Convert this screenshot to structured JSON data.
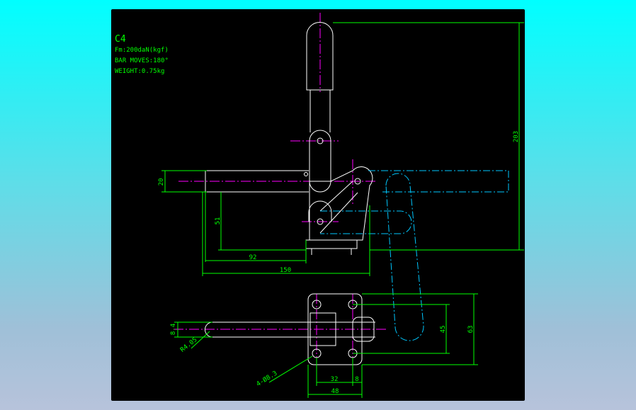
{
  "notes": {
    "title": "C4",
    "force": "Fm:200daN(kgf)",
    "bar_moves": "BAR MOVES:180°",
    "weight": "WEIGHT:0.75kg"
  },
  "dimensions": {
    "height_overall": "203",
    "bar_height": "20",
    "pivot_height": "51",
    "length_to_pivot": "92",
    "length_overall": "150",
    "slot_width": "8.4",
    "slot_radius": "R4.05",
    "hole_diameter": "4-Ø8.3",
    "base_hole_spacing": "32",
    "base_edge": "8",
    "base_width": "48",
    "base_hole_spacing_v": "45",
    "base_depth": "63"
  },
  "colors": {
    "background_top": "#00ffff",
    "canvas": "#000000",
    "outline": "#ffffff",
    "dimension": "#00ff00",
    "centerline": "#ff00ff",
    "phantom": "#00c8ff"
  }
}
